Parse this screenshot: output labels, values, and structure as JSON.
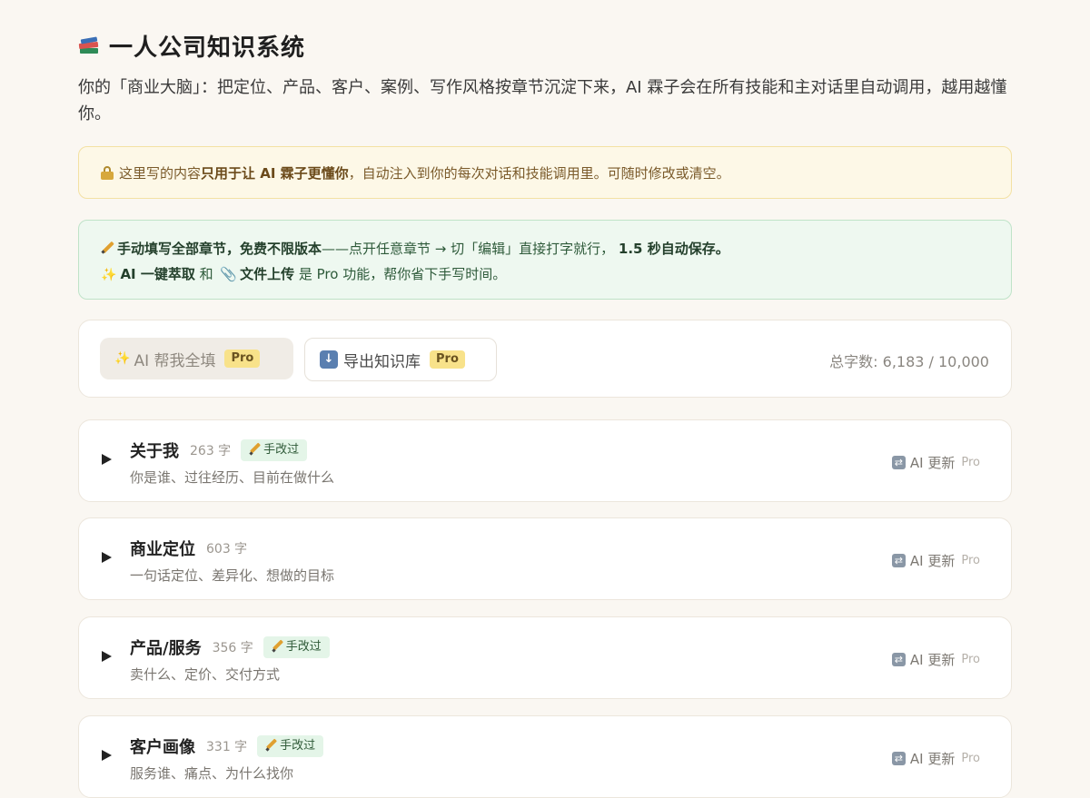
{
  "header": {
    "icon": "books-icon",
    "title": "一人公司知识系统",
    "subtitle": "你的「商业大脑」：把定位、产品、客户、案例、写作风格按章节沉淀下来，AI 霖子会在所有技能和主对话里自动调用，越用越懂你。"
  },
  "notice_privacy": {
    "icon": "lock-icon",
    "prefix": "这里写的内容",
    "bold": "只用于让 AI 霖子更懂你",
    "suffix": "，自动注入到你的每次对话和技能调用里。可随时修改或清空。"
  },
  "notice_manual": {
    "line1_bold": "手动填写全部章节，免费不限版本",
    "line1_rest": "——点开任意章节 → 切「编辑」直接打字就行，",
    "line1_bold2": "1.5 秒自动保存。",
    "line2_bold1": "AI 一键萃取",
    "line2_mid": " 和 ",
    "line2_bold2": "文件上传",
    "line2_rest": " 是 Pro 功能，帮你省下手写时间。"
  },
  "toolbar": {
    "ai_fill_label": "AI 帮我全填",
    "export_label": "导出知识库",
    "pro_label": "Pro",
    "word_count": "总字数: 6,183 / 10,000"
  },
  "sections": [
    {
      "title": "关于我",
      "count": "263 字",
      "edited": "手改过",
      "desc": "你是谁、过往经历、目前在做什么",
      "ai_update": "AI 更新",
      "pro": "Pro"
    },
    {
      "title": "商业定位",
      "count": "603 字",
      "edited": "",
      "desc": "一句话定位、差异化、想做的目标",
      "ai_update": "AI 更新",
      "pro": "Pro"
    },
    {
      "title": "产品/服务",
      "count": "356 字",
      "edited": "手改过",
      "desc": "卖什么、定价、交付方式",
      "ai_update": "AI 更新",
      "pro": "Pro"
    },
    {
      "title": "客户画像",
      "count": "331 字",
      "edited": "手改过",
      "desc": "服务谁、痛点、为什么找你",
      "ai_update": "AI 更新",
      "pro": "Pro"
    }
  ]
}
